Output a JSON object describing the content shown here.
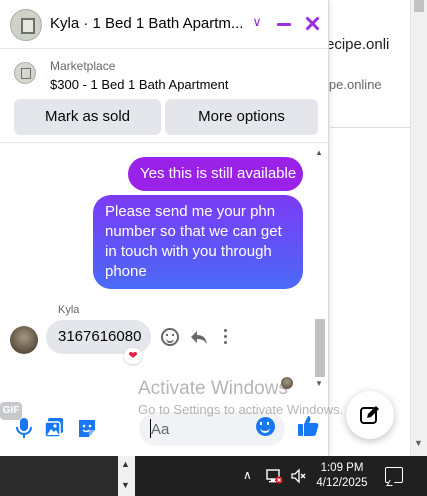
{
  "background_page": {
    "line1": "ecipe.onli",
    "line2": "ipe.online"
  },
  "chat": {
    "header": {
      "title": "Kyla · 1 Bed 1 Bath Apartm...",
      "chevron": "∨"
    },
    "listing": {
      "source": "Marketplace",
      "title": "$300 - 1 Bed 1 Bath Apartment",
      "mark_sold_label": "Mark as sold",
      "more_options_label": "More options"
    },
    "messages": [
      {
        "from": "me",
        "text": "Yes this is still available"
      },
      {
        "from": "me",
        "text": "Please send me your phn number so that we can get in touch with you through phone"
      },
      {
        "from": "Kyla",
        "sender_label": "Kyla",
        "text": "3167616080",
        "reaction": "❤"
      }
    ],
    "composer": {
      "gif_label": "GIF",
      "placeholder": "Aa"
    }
  },
  "watermark": {
    "title": "Activate Windows",
    "subtitle": "Go to Settings to activate Windows."
  },
  "taskbar": {
    "tray_chevron": "∧",
    "time": "1:09 PM",
    "date": "4/12/2025"
  },
  "colors": {
    "messenger_purple": "#9a22e8",
    "gradient_start": "#7b3bf5",
    "gradient_end": "#4a6bf7",
    "accent_blue": "#1877f2",
    "reaction_red": "#e41e3f"
  },
  "icons": [
    "chevron-down-icon",
    "minimize-icon",
    "close-icon",
    "mic-icon",
    "photo-icon",
    "sticker-icon",
    "gif-icon",
    "emoji-icon",
    "like-icon",
    "compose-icon",
    "reply-icon",
    "more-icon",
    "network-icon",
    "volume-mute-icon",
    "notification-icon"
  ]
}
